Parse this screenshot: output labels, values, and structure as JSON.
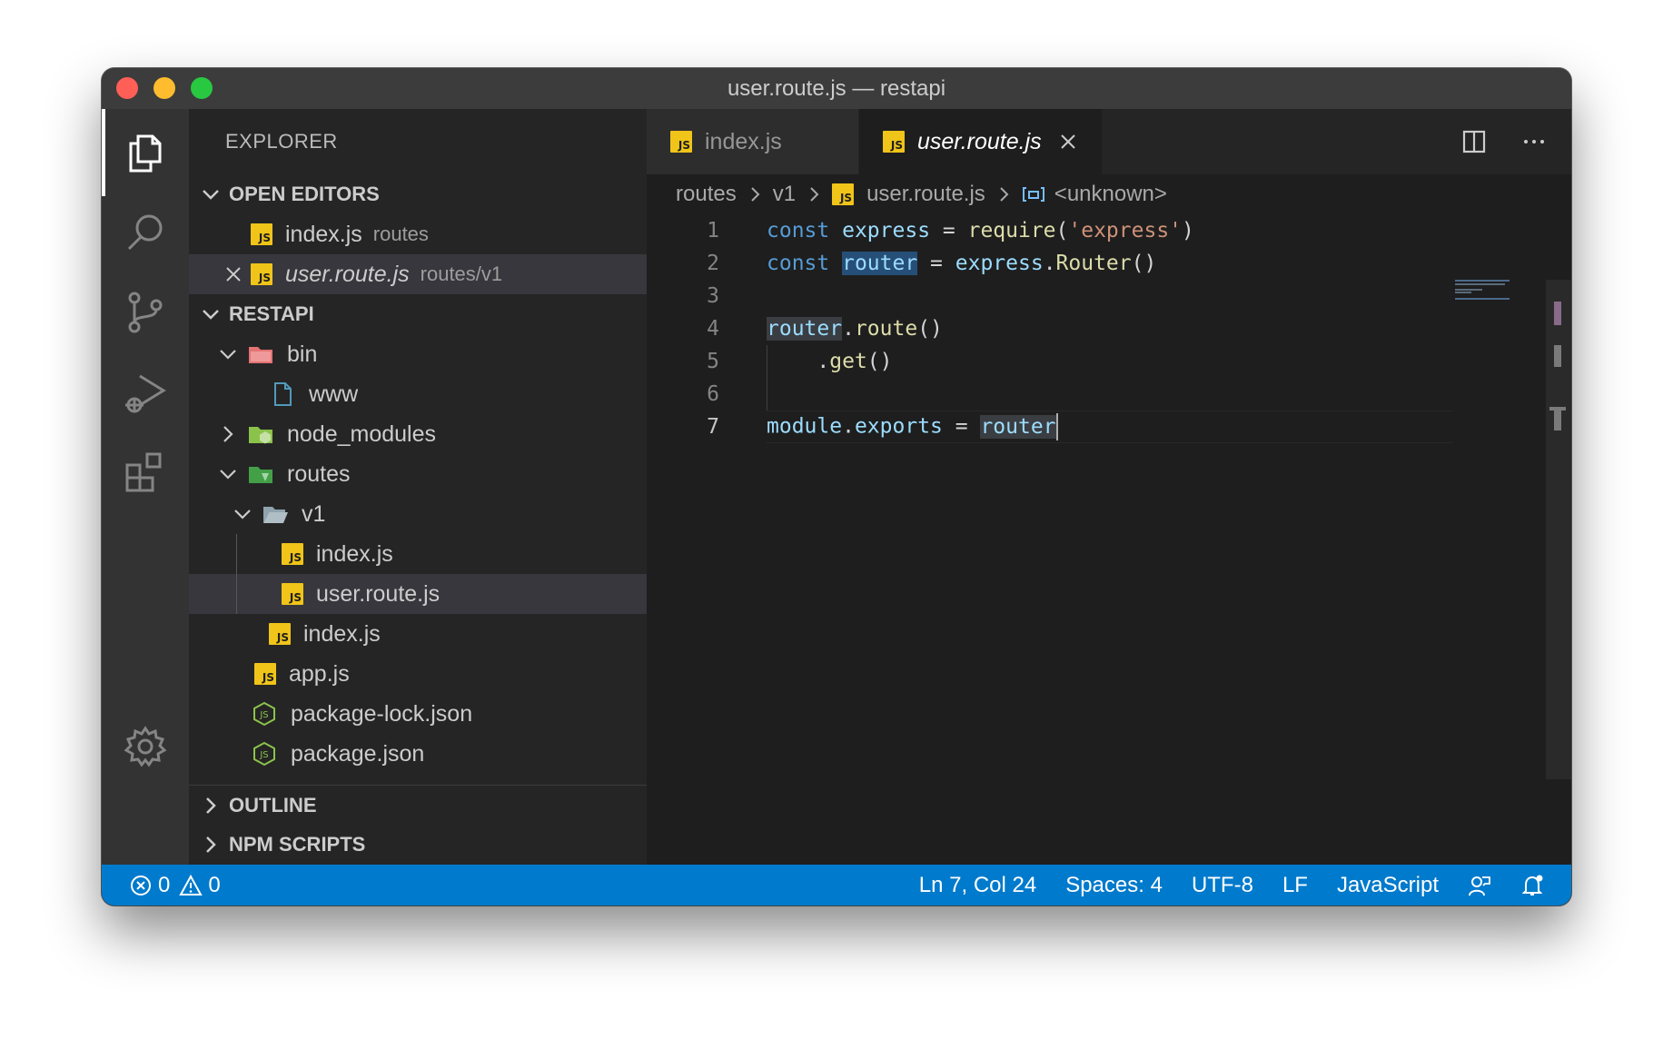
{
  "window": {
    "title": "user.route.js — restapi"
  },
  "activity_bar": {
    "items": [
      "explorer-icon",
      "search-icon",
      "source-control-icon",
      "run-debug-icon",
      "extensions-icon"
    ],
    "bottom": "settings-gear-icon"
  },
  "sidebar": {
    "title": "EXPLORER",
    "open_editors": {
      "header": "OPEN EDITORS",
      "items": [
        {
          "name": "index.js",
          "path": "routes"
        },
        {
          "name": "user.route.js",
          "path": "routes/v1"
        }
      ]
    },
    "project": {
      "header": "RESTAPI",
      "tree": [
        {
          "name": "bin"
        },
        {
          "name": "www"
        },
        {
          "name": "node_modules"
        },
        {
          "name": "routes"
        },
        {
          "name": "v1"
        },
        {
          "name": "index.js"
        },
        {
          "name": "user.route.js"
        },
        {
          "name": "index.js"
        },
        {
          "name": "app.js"
        },
        {
          "name": "package-lock.json"
        },
        {
          "name": "package.json"
        }
      ]
    },
    "outline_header": "OUTLINE",
    "npm_scripts_header": "NPM SCRIPTS"
  },
  "editor": {
    "tabs": [
      {
        "label": "index.js",
        "active": false
      },
      {
        "label": "user.route.js",
        "active": true
      }
    ],
    "breadcrumb": [
      "routes",
      "v1",
      "user.route.js",
      "<unknown>"
    ],
    "line_numbers": [
      "1",
      "2",
      "3",
      "4",
      "5",
      "6",
      "7"
    ],
    "code": {
      "l1": {
        "kw": "const",
        "var": "express",
        "eq": " = ",
        "fn": "require",
        "open": "(",
        "str": "'express'",
        "close": ")"
      },
      "l2": {
        "kw": "const",
        "var": "router",
        "eq": " = ",
        "obj": "express",
        "dot": ".",
        "fn": "Router",
        "parens": "()"
      },
      "l4": {
        "obj": "router",
        "dot": ".",
        "fn": "route",
        "parens": "()"
      },
      "l5": {
        "dot": ".",
        "fn": "get",
        "parens": "()"
      },
      "l7": {
        "obj": "module",
        "dot": ".",
        "prop": "exports",
        "eq": " = ",
        "val": "router"
      }
    }
  },
  "status_bar": {
    "errors": "0",
    "warnings": "0",
    "position": "Ln 7, Col 24",
    "spaces": "Spaces: 4",
    "encoding": "UTF-8",
    "eol": "LF",
    "language": "JavaScript"
  },
  "colors": {
    "status_bar": "#007acc",
    "js_icon": "#f0c419",
    "keyword": "#569cd6",
    "variable": "#9cdcfe",
    "function": "#dcdcaa",
    "string": "#ce9178"
  }
}
